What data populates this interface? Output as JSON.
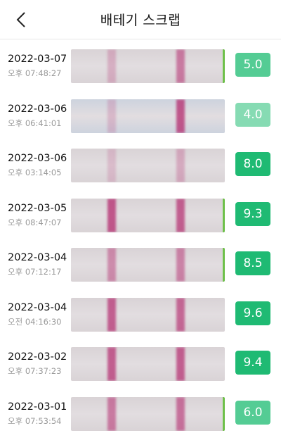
{
  "header": {
    "title": "배테기 스크랩",
    "back_icon": "chevron-left-icon"
  },
  "colors": {
    "score_dark": "#1fba73",
    "score_mid": "#54cc94",
    "score_light": "#86dbb3",
    "edge_green": "#6ec04a",
    "strip_bg": "#d9d3d6",
    "strip_bg_blue": "#cdd3de",
    "line_color": "#b42a6e"
  },
  "records": [
    {
      "date": "2022-03-07",
      "time": "오후 07:48:27",
      "score": "5.0",
      "tone": "mid",
      "intensity": [
        0.25,
        0.55
      ],
      "bg": "warm",
      "edge": true
    },
    {
      "date": "2022-03-06",
      "time": "오후 06:41:01",
      "score": "4.0",
      "tone": "light",
      "intensity": [
        0.2,
        0.75
      ],
      "bg": "blue",
      "edge": false
    },
    {
      "date": "2022-03-06",
      "time": "오후 03:14:05",
      "score": "8.0",
      "tone": "dark",
      "intensity": [
        0.18,
        0.28
      ],
      "bg": "warm",
      "edge": false
    },
    {
      "date": "2022-03-05",
      "time": "오후 08:47:07",
      "score": "9.3",
      "tone": "dark",
      "intensity": [
        0.75,
        0.7
      ],
      "bg": "warm",
      "edge": true
    },
    {
      "date": "2022-03-04",
      "time": "오후 07:12:17",
      "score": "8.5",
      "tone": "dark",
      "intensity": [
        0.45,
        0.5
      ],
      "bg": "warm",
      "edge": true
    },
    {
      "date": "2022-03-04",
      "time": "오전 04:16:30",
      "score": "9.6",
      "tone": "dark",
      "intensity": [
        0.7,
        0.65
      ],
      "bg": "warm",
      "edge": false
    },
    {
      "date": "2022-03-02",
      "time": "오후 07:37:23",
      "score": "9.4",
      "tone": "dark",
      "intensity": [
        0.7,
        0.7
      ],
      "bg": "warm",
      "edge": false
    },
    {
      "date": "2022-03-01",
      "time": "오후 07:53:54",
      "score": "6.0",
      "tone": "mid",
      "intensity": [
        0.55,
        0.6
      ],
      "bg": "warm",
      "edge": true
    }
  ]
}
